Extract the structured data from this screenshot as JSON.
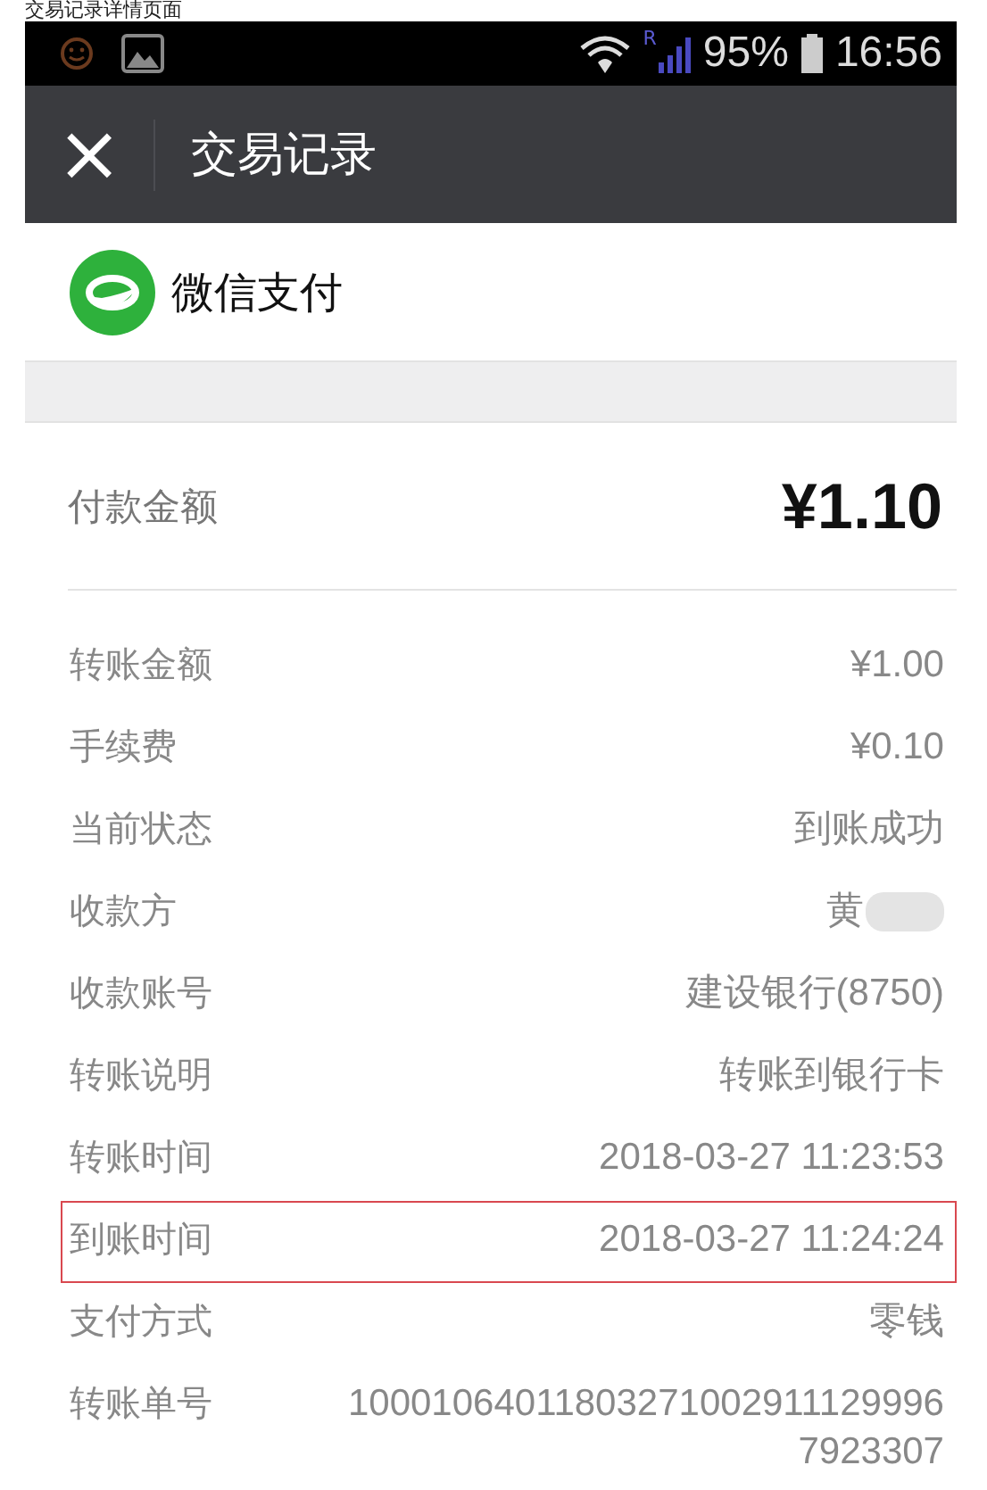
{
  "caption": "交易记录详情页面",
  "status_bar": {
    "roaming": "R",
    "battery": "95%",
    "time": "16:56"
  },
  "title_bar": {
    "close": "×",
    "title": "交易记录"
  },
  "brand": {
    "name": "微信支付"
  },
  "amount": {
    "label": "付款金额",
    "value": "¥1.10"
  },
  "details": [
    {
      "label": "转账金额",
      "value": "¥1.00",
      "highlighted": false
    },
    {
      "label": "手续费",
      "value": "¥0.10",
      "highlighted": false
    },
    {
      "label": "当前状态",
      "value": "到账成功",
      "highlighted": false
    },
    {
      "label": "收款方",
      "value": "黄",
      "redacted": true,
      "highlighted": false
    },
    {
      "label": "收款账号",
      "value": "建设银行(8750)",
      "highlighted": false
    },
    {
      "label": "转账说明",
      "value": "转账到银行卡",
      "highlighted": false
    },
    {
      "label": "转账时间",
      "value": "2018-03-27 11:23:53",
      "highlighted": false
    },
    {
      "label": "到账时间",
      "value": "2018-03-27 11:24:24",
      "highlighted": true
    },
    {
      "label": "支付方式",
      "value": "零钱",
      "highlighted": false
    },
    {
      "label": "转账单号",
      "value": "100010640118032710029111299967923307",
      "highlighted": false
    }
  ]
}
